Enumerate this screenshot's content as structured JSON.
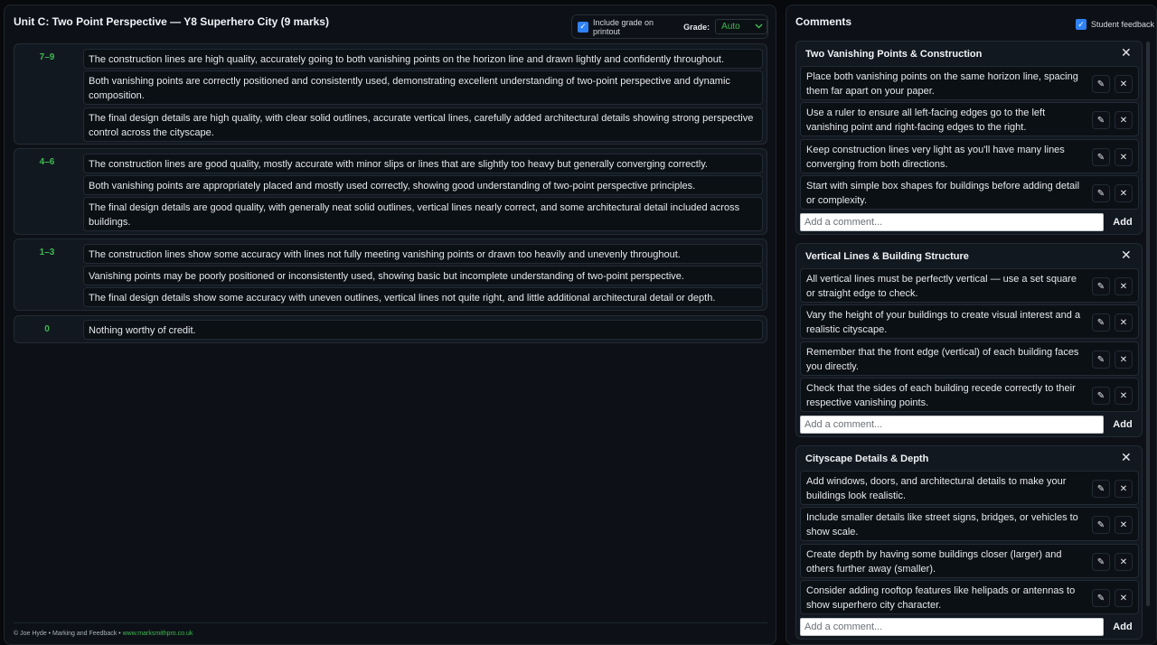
{
  "header": {
    "title": "Unit C: Two Point Perspective — Y8 Superhero City (9 marks)",
    "include_grade_label": "Include grade on printout",
    "grade_label": "Grade:",
    "grade_value": "Auto"
  },
  "bands": [
    {
      "label": "7–9",
      "criteria": [
        "The construction lines are high quality, accurately going to both vanishing points on the horizon line and drawn lightly and confidently throughout.",
        "Both vanishing points are correctly positioned and consistently used, demonstrating excellent understanding of two-point perspective and dynamic composition.",
        "The final design details are high quality, with clear solid outlines, accurate vertical lines, carefully added architectural details showing strong perspective control across the cityscape."
      ]
    },
    {
      "label": "4–6",
      "criteria": [
        "The construction lines are good quality, mostly accurate with minor slips or lines that are slightly too heavy but generally converging correctly.",
        "Both vanishing points are appropriately placed and mostly used correctly, showing good understanding of two-point perspective principles.",
        "The final design details are good quality, with generally neat solid outlines, vertical lines nearly correct, and some architectural detail included across buildings."
      ]
    },
    {
      "label": "1–3",
      "criteria": [
        "The construction lines show some accuracy with lines not fully meeting vanishing points or drawn too heavily and unevenly throughout.",
        "Vanishing points may be poorly positioned or inconsistently used, showing basic but incomplete understanding of two-point perspective.",
        "The final design details show some accuracy with uneven outlines, vertical lines not quite right, and little additional architectural detail or depth."
      ]
    },
    {
      "label": "0",
      "criteria": [
        "Nothing worthy of credit."
      ]
    }
  ],
  "footer": {
    "text": "© Joe Hyde • Marking and Feedback •",
    "link": "www.marksmithpro.co.uk"
  },
  "comments_panel": {
    "title": "Comments",
    "student_feedback_label": "Student feedback",
    "add_placeholder": "Add a comment...",
    "add_label": "Add",
    "groups": [
      {
        "title": "Two Vanishing Points & Construction",
        "comments": [
          "Place both vanishing points on the same horizon line, spacing them far apart on your paper.",
          "Use a ruler to ensure all left-facing edges go to the left vanishing point and right-facing edges to the right.",
          "Keep construction lines very light as you'll have many lines converging from both directions.",
          "Start with simple box shapes for buildings before adding detail or complexity."
        ]
      },
      {
        "title": "Vertical Lines & Building Structure",
        "comments": [
          "All vertical lines must be perfectly vertical — use a set square or straight edge to check.",
          "Vary the height of your buildings to create visual interest and a realistic cityscape.",
          "Remember that the front edge (vertical) of each building faces you directly.",
          "Check that the sides of each building recede correctly to their respective vanishing points."
        ]
      },
      {
        "title": "Cityscape Details & Depth",
        "comments": [
          "Add windows, doors, and architectural details to make your buildings look realistic.",
          "Include smaller details like street signs, bridges, or vehicles to show scale.",
          "Create depth by having some buildings closer (larger) and others further away (smaller).",
          "Consider adding rooftop features like helipads or antennas to show superhero city character."
        ]
      }
    ]
  }
}
